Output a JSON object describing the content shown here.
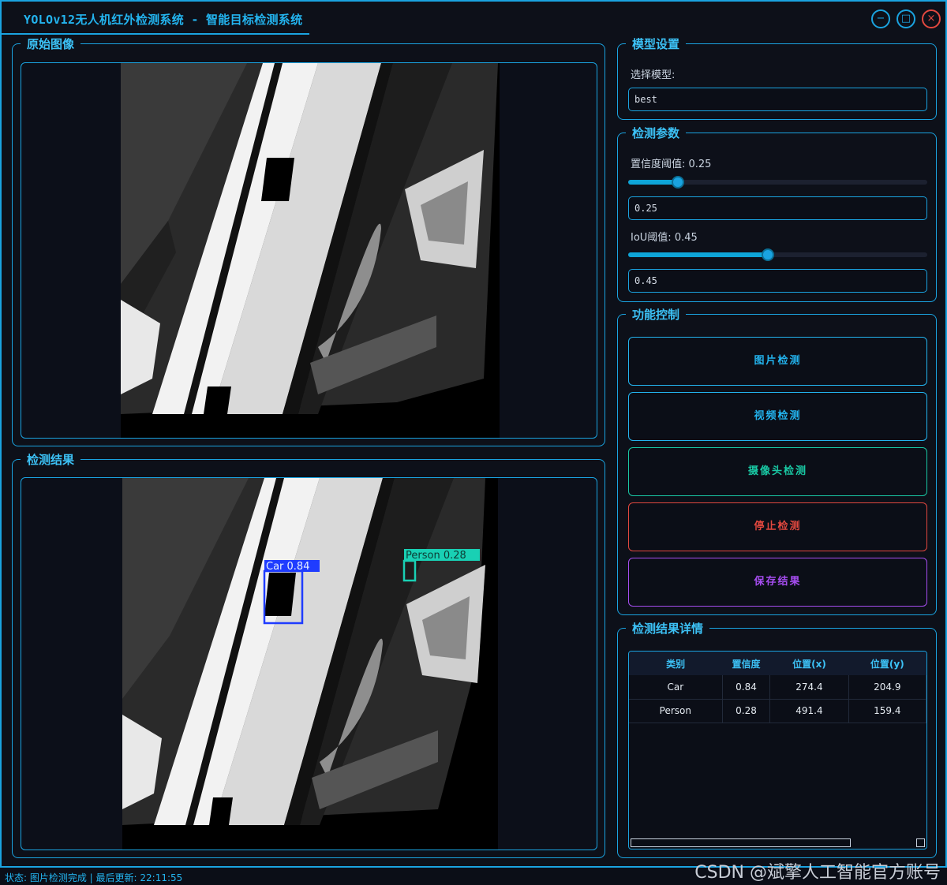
{
  "app": {
    "title": "YOLOv12无人机红外检测系统 - 智能目标检测系统",
    "btn_min": "−",
    "btn_max": "□",
    "btn_close": "×"
  },
  "left": {
    "original_title": "原始图像",
    "result_title": "检测结果",
    "detections": [
      {
        "label": "Car 0.84",
        "color": "#1f3cff"
      },
      {
        "label": "Person 0.28",
        "color": "#19d0b4"
      }
    ]
  },
  "model": {
    "group_title": "模型设置",
    "select_label": "选择模型:",
    "selected_model": "best"
  },
  "params": {
    "group_title": "检测参数",
    "conf_label": "置信度阈值: 0.25",
    "conf_value": "0.25",
    "conf_level": 0.25,
    "iou_label": "IoU阈值: 0.45",
    "iou_value": "0.45",
    "iou_level": 0.45
  },
  "controls": {
    "group_title": "功能控制",
    "buttons": [
      {
        "label": "图片检测",
        "color": "#23b4ef"
      },
      {
        "label": "视频检测",
        "color": "#23b4ef"
      },
      {
        "label": "摄像头检测",
        "color": "#19c8a4"
      },
      {
        "label": "停止检测",
        "color": "#e2483f"
      },
      {
        "label": "保存结果",
        "color": "#a64df0"
      }
    ]
  },
  "results": {
    "group_title": "检测结果详情",
    "headers": [
      "类别",
      "置信度",
      "位置(x)",
      "位置(y)"
    ],
    "rows": [
      [
        "Car",
        "0.84",
        "274.4",
        "204.9"
      ],
      [
        "Person",
        "0.28",
        "491.4",
        "159.4"
      ]
    ]
  },
  "status": {
    "text": "状态: 图片检测完成 | 最后更新: 22:11:55"
  },
  "watermark": "CSDN @斌擎人工智能官方账号"
}
